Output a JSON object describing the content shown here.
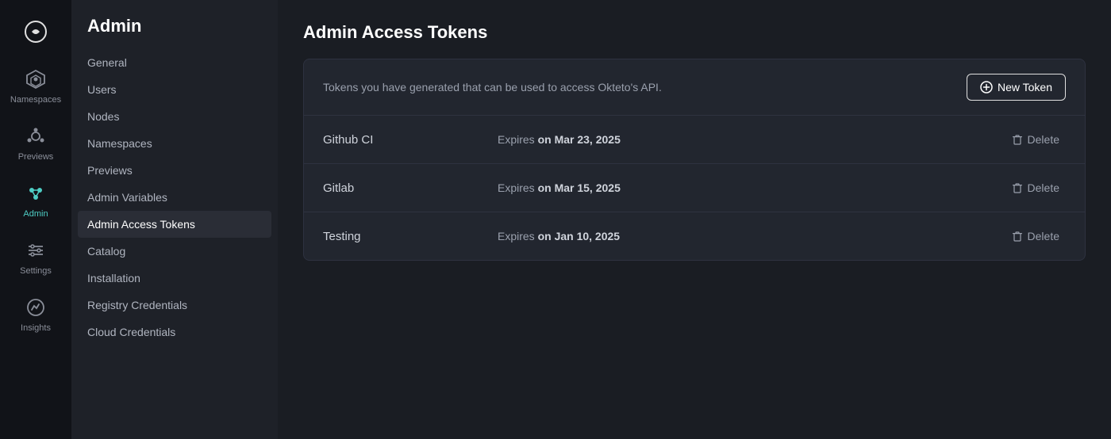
{
  "icon_sidebar": {
    "items": [
      {
        "id": "logo",
        "label": "",
        "active": false
      },
      {
        "id": "namespaces",
        "label": "Namespaces",
        "active": false
      },
      {
        "id": "previews",
        "label": "Previews",
        "active": false
      },
      {
        "id": "admin",
        "label": "Admin",
        "active": true
      },
      {
        "id": "settings",
        "label": "Settings",
        "active": false
      },
      {
        "id": "insights",
        "label": "Insights",
        "active": false
      }
    ]
  },
  "nav_sidebar": {
    "title": "Admin",
    "items": [
      {
        "id": "general",
        "label": "General",
        "active": false
      },
      {
        "id": "users",
        "label": "Users",
        "active": false
      },
      {
        "id": "nodes",
        "label": "Nodes",
        "active": false
      },
      {
        "id": "namespaces",
        "label": "Namespaces",
        "active": false
      },
      {
        "id": "previews",
        "label": "Previews",
        "active": false
      },
      {
        "id": "admin-variables",
        "label": "Admin Variables",
        "active": false
      },
      {
        "id": "admin-access-tokens",
        "label": "Admin Access Tokens",
        "active": true
      },
      {
        "id": "catalog",
        "label": "Catalog",
        "active": false
      },
      {
        "id": "installation",
        "label": "Installation",
        "active": false
      },
      {
        "id": "registry-credentials",
        "label": "Registry Credentials",
        "active": false
      },
      {
        "id": "cloud-credentials",
        "label": "Cloud Credentials",
        "active": false
      }
    ]
  },
  "main": {
    "page_title": "Admin Access Tokens",
    "info_text": "Tokens you have generated that can be used to access Okteto's API.",
    "new_token_btn_label": "New Token",
    "tokens": [
      {
        "name": "Github CI",
        "expires_prefix": "Expires ",
        "expires_label": "on Mar 23, 2025"
      },
      {
        "name": "Gitlab",
        "expires_prefix": "Expires ",
        "expires_label": "on Mar 15, 2025"
      },
      {
        "name": "Testing",
        "expires_prefix": "Expires ",
        "expires_label": "on Jan 10, 2025"
      }
    ],
    "delete_label": "Delete"
  },
  "colors": {
    "active_nav": "#4ecdc4",
    "accent": "#4ecdc4"
  }
}
